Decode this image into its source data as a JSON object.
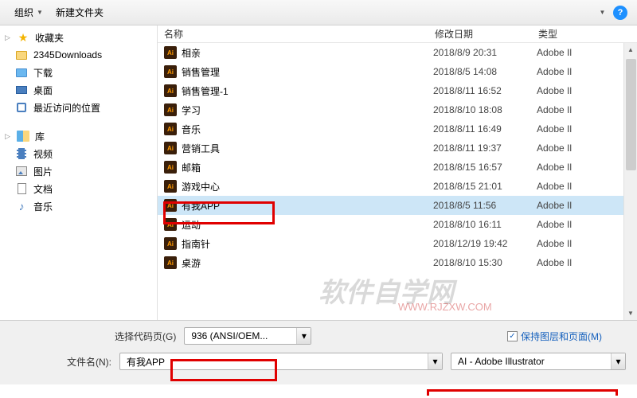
{
  "toolbar": {
    "organize": "组织",
    "new_folder": "新建文件夹"
  },
  "sidebar": {
    "favorites": {
      "label": "收藏夹"
    },
    "downloads": {
      "label": "2345Downloads"
    },
    "xiazai": {
      "label": "下载"
    },
    "desktop": {
      "label": "桌面"
    },
    "recent": {
      "label": "最近访问的位置"
    },
    "library": {
      "label": "库"
    },
    "video": {
      "label": "视频"
    },
    "pictures": {
      "label": "图片"
    },
    "documents": {
      "label": "文档"
    },
    "music": {
      "label": "音乐"
    }
  },
  "columns": {
    "name": "名称",
    "date": "修改日期",
    "type": "类型"
  },
  "files": [
    {
      "name": "相亲",
      "date": "2018/8/9 20:31",
      "type": "Adobe Il"
    },
    {
      "name": "销售管理",
      "date": "2018/8/5 14:08",
      "type": "Adobe Il"
    },
    {
      "name": "销售管理-1",
      "date": "2018/8/11 16:52",
      "type": "Adobe Il"
    },
    {
      "name": "学习",
      "date": "2018/8/10 18:08",
      "type": "Adobe Il"
    },
    {
      "name": "音乐",
      "date": "2018/8/11 16:49",
      "type": "Adobe Il"
    },
    {
      "name": "营销工具",
      "date": "2018/8/11 19:37",
      "type": "Adobe Il"
    },
    {
      "name": "邮箱",
      "date": "2018/8/15 16:57",
      "type": "Adobe Il"
    },
    {
      "name": "游戏中心",
      "date": "2018/8/15 21:01",
      "type": "Adobe Il"
    },
    {
      "name": "有我APP",
      "date": "2018/8/5 11:56",
      "type": "Adobe Il",
      "selected": true
    },
    {
      "name": "运动",
      "date": "2018/8/10 16:11",
      "type": "Adobe Il"
    },
    {
      "name": "指南针",
      "date": "2018/12/19 19:42",
      "type": "Adobe Il"
    },
    {
      "name": "桌游",
      "date": "2018/8/10 15:30",
      "type": "Adobe Il"
    }
  ],
  "footer": {
    "codepage_label": "选择代码页(G)",
    "codepage_value": "936   (ANSI/OEM...",
    "preserve_layers": "保持图层和页面(M)",
    "filename_label": "文件名(N):",
    "filename_value": "有我APP",
    "filetype_value": "AI - Adobe Illustrator"
  },
  "watermark": {
    "main": "软件自学网",
    "sub": "WWW.RJZXW.COM"
  }
}
